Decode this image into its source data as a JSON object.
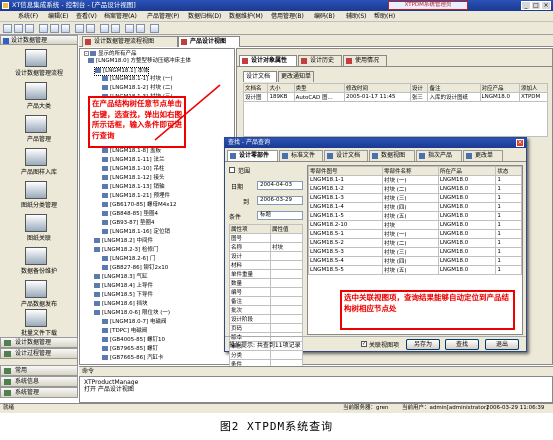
{
  "window": {
    "title": "XT信息集成系统 - 控制台 - [产品设计视图]",
    "badge": "XTPDM系统管理员",
    "min": "_",
    "max": "□",
    "close": "×"
  },
  "menu": [
    "系统(F)",
    "编辑(E)",
    "查看(V)",
    "档案管理(A)",
    "产品管理(P)",
    "数据归档(D)",
    "数据维护(M)",
    "借用管理(B)",
    "编码(B)",
    "辅助(S)",
    "帮助(H)"
  ],
  "left_panel": {
    "header": "设计数据管理",
    "items": [
      "设计数据管理流程",
      "产品大类",
      "产品管理",
      "产品图样入库",
      "图纸分类管理",
      "图纸关联",
      "数据备份维护",
      "产品数据发布",
      "批量文件下载"
    ],
    "bottom_items": [
      "设计数据管理",
      "设计过程管理",
      "常用",
      "系统信息",
      "系统管理"
    ]
  },
  "tabs": [
    "设计数据管理流程视图",
    "产品设计视图"
  ],
  "tree": {
    "root": "显示的所有产品",
    "nodes": [
      "[LNGM18.0] 方整型移动压缩冲床主体",
      "[LNGM18.1] 本体",
      "[LNGM18.1-1] 衬块 (一)",
      "[LNGM18.1-2] 衬块 (二)",
      "[LNGM18.1-3] 衬块 (三)",
      "[LNGM18.1-4] 衬块 (四)",
      "[LNGM18.1-5] 衬块 (五)",
      "[LNGM18.1-6] 衬板 (六)",
      "[LNGM18.1-7] 压板",
      "[LNGM18.1-9] 连接法兰",
      "[LNGM18.1-8] 盖板",
      "[LNGM18.1-11] 法兰",
      "[LNGM18.1-10] 吊柱",
      "[LNGM18.1-12] 接头",
      "[LNGM18.1-13] 销轴",
      "[LNGM18.1-21] 预埋件",
      "[GB6170-85] 螺母M4x12",
      "[GB848-85] 垫圈4",
      "[GB93-87] 垫圈4",
      "[LNGM18.1-16] 定位销",
      "[LNGM18.2] 中间件",
      "[LNGM18.2-3] 检修门",
      "[LNGM18.2-6] 门",
      "[GB827-86] 铆钉2x10",
      "[LNGM18.3] 气缸",
      "[LNGM18.4] 上导件",
      "[LNGM18.5] 下导件",
      "[LNGM18.6] 挡块",
      "[LNGM18.0-6] 限位块 (一)",
      "[LNGM18.0-7] 电磁阀",
      "[TDPC] 电磁阀",
      "[GB4005-85] 螺钉10",
      "[GB7965-85] 螺钉",
      "[GB7665-86] 汽缸卡"
    ],
    "highlight": "[LNGM18.1] 本体"
  },
  "right": {
    "tabs": [
      "设计对象属性",
      "设计历史",
      "使用情况"
    ],
    "subtabs": [
      "设计文档",
      "更改通知单"
    ],
    "columns": [
      "文档名",
      "大小",
      "类型",
      "修改时间",
      "设计",
      "备注",
      "对应产品",
      "添加人"
    ],
    "row": [
      "设计图",
      "189KB",
      "AutoCAD 图...",
      "2005-01-17 11:45",
      "张三",
      "入库的设计图纸",
      "LNGM18.0",
      "XTPDM"
    ]
  },
  "annotation_left": "在产品结构树任意节点单击右键，选查找，弹出如右图所示话框，输入条件即可进行查询",
  "annotation_right": "选中关联视图项，查询结果能够自动定位到产品结构树相应节点处",
  "dialog": {
    "title": "查找 - 产品查询",
    "close": "×",
    "tabs": [
      "设计零部件",
      "标准文件",
      "设计文档",
      "数据视图",
      "指次产品",
      "更改单"
    ],
    "range_label": "范围",
    "date_label": "日期",
    "date_from": "2004-04-03",
    "to_label": "到",
    "date_to": "2006-03-29",
    "condition_label": "条件",
    "condition_value": "标题",
    "attr_cols": [
      "属性项",
      "属性值"
    ],
    "attr_rows": [
      [
        "图号",
        ""
      ],
      [
        "名称",
        "衬块"
      ],
      [
        "设计",
        ""
      ],
      [
        "材料",
        ""
      ],
      [
        "单件重量",
        ""
      ],
      [
        "数量",
        ""
      ],
      [
        "编号",
        ""
      ],
      [
        "备注",
        ""
      ],
      [
        "批次",
        ""
      ],
      [
        "设计阶段",
        ""
      ],
      [
        "页码",
        ""
      ],
      [
        "版本",
        ""
      ],
      [
        "审核",
        ""
      ],
      [
        "分类",
        ""
      ],
      [
        "条件",
        ""
      ],
      [
        "说明",
        ""
      ]
    ],
    "result_cols": [
      "零部件图号",
      "零部件名称",
      "所在产品",
      "状态"
    ],
    "result_rows": [
      [
        "LNGM18.1-1",
        "衬块 (一)",
        "LNGM18.0",
        "1"
      ],
      [
        "LNGM18.1-2",
        "衬块 (二)",
        "LNGM18.0",
        "1"
      ],
      [
        "LNGM18.1-3",
        "衬块 (三)",
        "LNGM18.0",
        "1"
      ],
      [
        "LNGM18.1-4",
        "衬块 (四)",
        "LNGM18.0",
        "1"
      ],
      [
        "LNGM18.1-5",
        "衬块 (五)",
        "LNGM18.0",
        "1"
      ],
      [
        "LNGM18.2-10",
        "衬块",
        "LNGM18.0",
        "1"
      ],
      [
        "LNGM18.5-1",
        "衬块 (一)",
        "LNGM18.0",
        "1"
      ],
      [
        "LNGM18.5-2",
        "衬块 (二)",
        "LNGM18.0",
        "1"
      ],
      [
        "LNGM18.5-3",
        "衬块 (三)",
        "LNGM18.0",
        "1"
      ],
      [
        "LNGM18.5-4",
        "衬块 (四)",
        "LNGM18.0",
        "1"
      ],
      [
        "LNGM18.5-5",
        "衬块 (五)",
        "LNGM18.0",
        "1"
      ]
    ],
    "status": "操作提示: 共查到11项记录",
    "checkbox_label": "关联视图项",
    "btn_save": "另存为",
    "btn_search": "查找",
    "btn_exit": "退出"
  },
  "command": {
    "label": "命令",
    "lines": [
      "XTProductManage",
      "打开 产品设计视图"
    ]
  },
  "status": {
    "left": "就绪",
    "server": "当前服务器：gren",
    "user": "当前用户：admin[administrator]",
    "time": "2006-03-29 11:06:39"
  },
  "caption": "图2  XTPDM系统查询"
}
